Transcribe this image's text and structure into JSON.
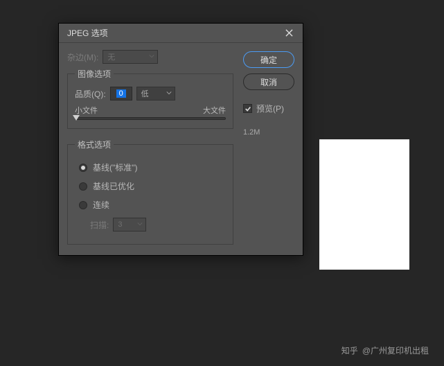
{
  "dialog": {
    "title": "JPEG 选项",
    "matte": {
      "label": "杂边(M):",
      "value": "无"
    },
    "image_options": {
      "legend": "图像选项",
      "quality_label": "品质(Q):",
      "quality_value": "0",
      "quality_preset": "低",
      "slider_min_label": "小文件",
      "slider_max_label": "大文件"
    },
    "format_options": {
      "legend": "格式选项",
      "baseline": "基线(\"标准\")",
      "optimized": "基线已优化",
      "progressive": "连续",
      "scans_label": "扫描:",
      "scans_value": "3"
    }
  },
  "buttons": {
    "ok": "确定",
    "cancel": "取消"
  },
  "preview": {
    "label": "预览(P)",
    "size": "1.2M"
  },
  "watermark": {
    "brand": "知乎",
    "author": "@广州复印机出租"
  }
}
